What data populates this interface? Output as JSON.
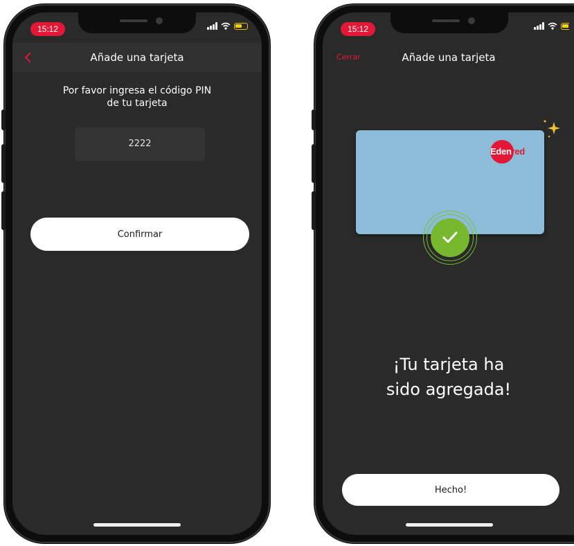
{
  "left_screen": {
    "status": {
      "time": "15:12"
    },
    "nav": {
      "title": "Añade una tarjeta",
      "back_icon": "chevron-left-icon"
    },
    "pin_prompt": {
      "line1": "Por favor ingresa el código PIN",
      "line2": "de tu tarjeta"
    },
    "pin_value": "2222",
    "confirm_label": "Confirmar"
  },
  "right_screen": {
    "status": {
      "time": "15:12"
    },
    "nav": {
      "title": "Añade una tarjeta",
      "close_label": "Cerrar"
    },
    "card": {
      "color": "#8dbcd9",
      "brand_logo": {
        "part1": "Eden",
        "part2": "red",
        "circle_color": "#e31837"
      }
    },
    "success": {
      "line1": "¡Tu tarjeta ha",
      "line2": "sido agregada!"
    },
    "done_label": "Hecho!"
  },
  "colors": {
    "accent": "#e31837",
    "success": "#77b82e",
    "screen_bg": "#2a2a2a",
    "navbar_bg": "#303030",
    "sparkle": "#f2c22f"
  }
}
